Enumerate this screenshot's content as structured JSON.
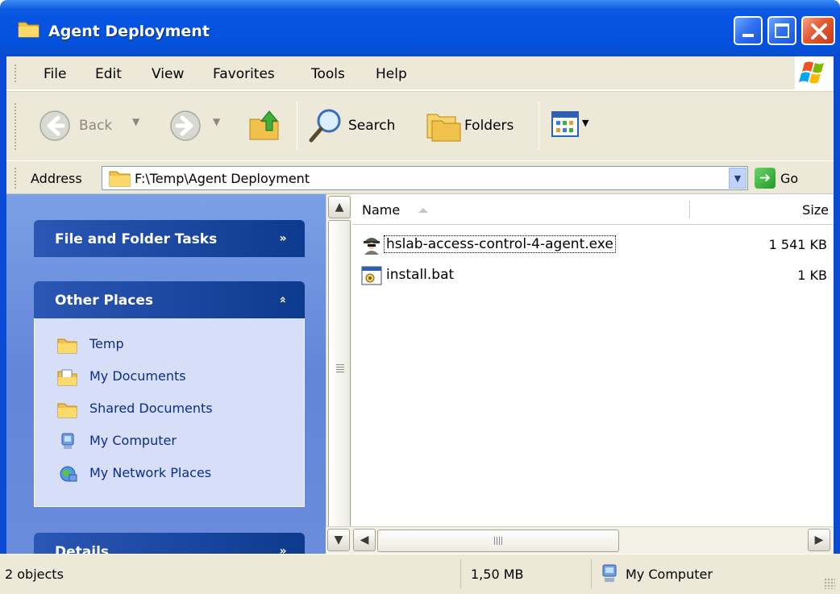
{
  "window": {
    "title": "Agent Deployment"
  },
  "menu": {
    "items": [
      "File",
      "Edit",
      "View",
      "Favorites",
      "Tools",
      "Help"
    ]
  },
  "toolbar": {
    "back_label": "Back",
    "search_label": "Search",
    "folders_label": "Folders"
  },
  "address": {
    "label": "Address",
    "value": "F:\\Temp\\Agent Deployment",
    "go_label": "Go"
  },
  "taskpane": {
    "file_folder_tasks": "File and Folder Tasks",
    "other_places": {
      "title": "Other Places",
      "items": [
        {
          "label": "Temp",
          "icon": "folder-icon"
        },
        {
          "label": "My Documents",
          "icon": "documents-folder-icon"
        },
        {
          "label": "Shared Documents",
          "icon": "folder-icon"
        },
        {
          "label": "My Computer",
          "icon": "computer-icon"
        },
        {
          "label": "My Network Places",
          "icon": "network-places-icon"
        }
      ]
    },
    "details": "Details"
  },
  "filelist": {
    "columns": {
      "name": "Name",
      "size": "Size"
    },
    "rows": [
      {
        "name": "hslab-access-control-4-agent.exe",
        "size": "1 541 KB",
        "icon": "spy-agent-exe-icon"
      },
      {
        "name": "install.bat",
        "size": "1 KB",
        "icon": "batch-file-icon"
      }
    ]
  },
  "status": {
    "objects": "2 objects",
    "size": "1,50 MB",
    "location": "My Computer"
  },
  "colors": {
    "title_blue": "#0554e3",
    "taskpane_blue": "#6385d8",
    "panel_body": "#d6dff7",
    "chrome": "#ece9d8",
    "close_red": "#e25a34"
  }
}
